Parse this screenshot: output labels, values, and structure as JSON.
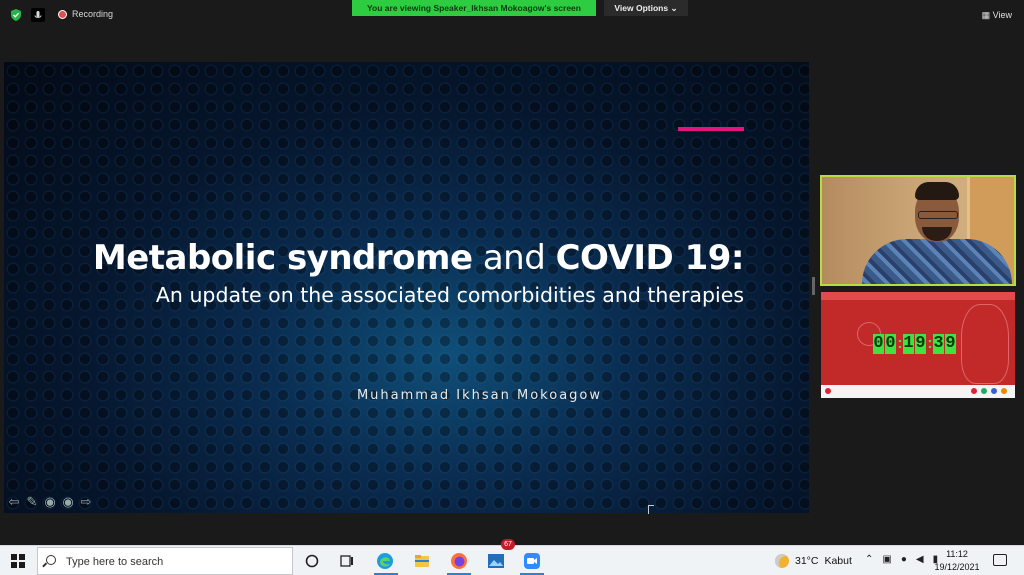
{
  "zoom_top": {
    "recording_label": "Recording",
    "viewing_banner": "You are viewing Speaker_Ikhsan Mokoagow's screen",
    "view_options_label": "View Options",
    "view_label": "View"
  },
  "slide": {
    "title_bold_1": "Metabolic syndrome",
    "title_normal": "and",
    "title_bold_2": "COVID 19:",
    "subtitle": "An update on the associated comorbidities and therapies",
    "author": "Muhammad Ikhsan Mokoagow",
    "accent_color": "#e0157d"
  },
  "shared_screen": {
    "timer": {
      "d1": "0",
      "d2": "0",
      "d3": "1",
      "d4": "9",
      "d5": "3",
      "d6": "9"
    },
    "timer_color": "#3fe33f"
  },
  "taskbar": {
    "search_placeholder": "Type here to search",
    "notification_count": "67",
    "weather_temp": "31°C",
    "weather_desc": "Kabut",
    "time": "11:12",
    "date": "19/12/2021"
  },
  "colors": {
    "active_speaker_border": "#b5dd3f",
    "banner_green": "#2ecc40"
  }
}
